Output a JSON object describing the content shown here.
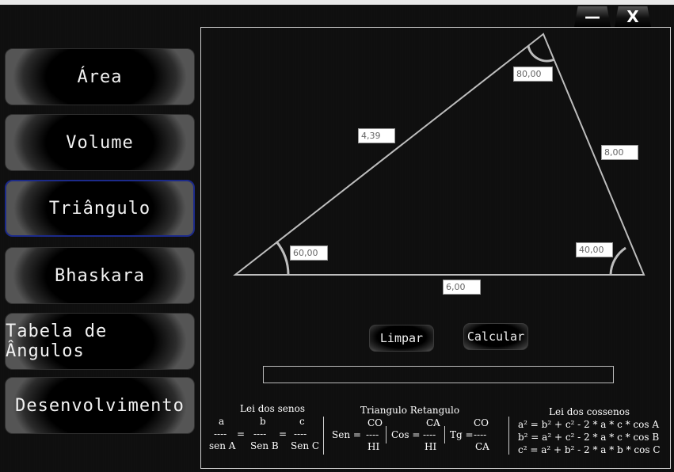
{
  "window": {
    "minimize_label": "—",
    "close_label": "X"
  },
  "nav": {
    "items": [
      {
        "label": "Área"
      },
      {
        "label": "Volume"
      },
      {
        "label": "Triângulo"
      },
      {
        "label": "Bhaskara"
      },
      {
        "label": "Tabela de Ângulos"
      },
      {
        "label": "Desenvolvimento"
      }
    ],
    "active": "Triângulo"
  },
  "triangle": {
    "side_left": "4,39",
    "side_right": "8,00",
    "side_bottom": "6,00",
    "angle_top": "80,00",
    "angle_left": "60,00",
    "angle_right": "40,00"
  },
  "actions": {
    "clear_label": "Limpar",
    "calc_label": "Calcular"
  },
  "result": {
    "value": ""
  },
  "formulas": {
    "senos": {
      "title": "Lei dos senos",
      "a": "a",
      "b": "b",
      "c": "c",
      "dash1": "----",
      "dash2": "----",
      "dash3": "----",
      "eq1": "=",
      "eq2": "=",
      "senA": "sen A",
      "senB": "Sen B",
      "senC": "Sen C"
    },
    "retangulo": {
      "title": "Triangulo Retangulo",
      "sen_label": "Sen =",
      "sen_num": "CO",
      "sen_dash": "----",
      "sen_den": "HI",
      "cos_label": "Cos =",
      "cos_num": "CA",
      "cos_dash": "----",
      "cos_den": "HI",
      "tg_label": "Tg =",
      "tg_num": "CO",
      "tg_dash": "----",
      "tg_den": "CA"
    },
    "cossenos": {
      "title": "Lei dos cossenos",
      "line1": "a² = b² + c² - 2 * a * c * cos A",
      "line2": "b² = a² + c² - 2 * a * c * cos B",
      "line3": "c² = a² + b² - 2 * a * b * cos C"
    }
  }
}
